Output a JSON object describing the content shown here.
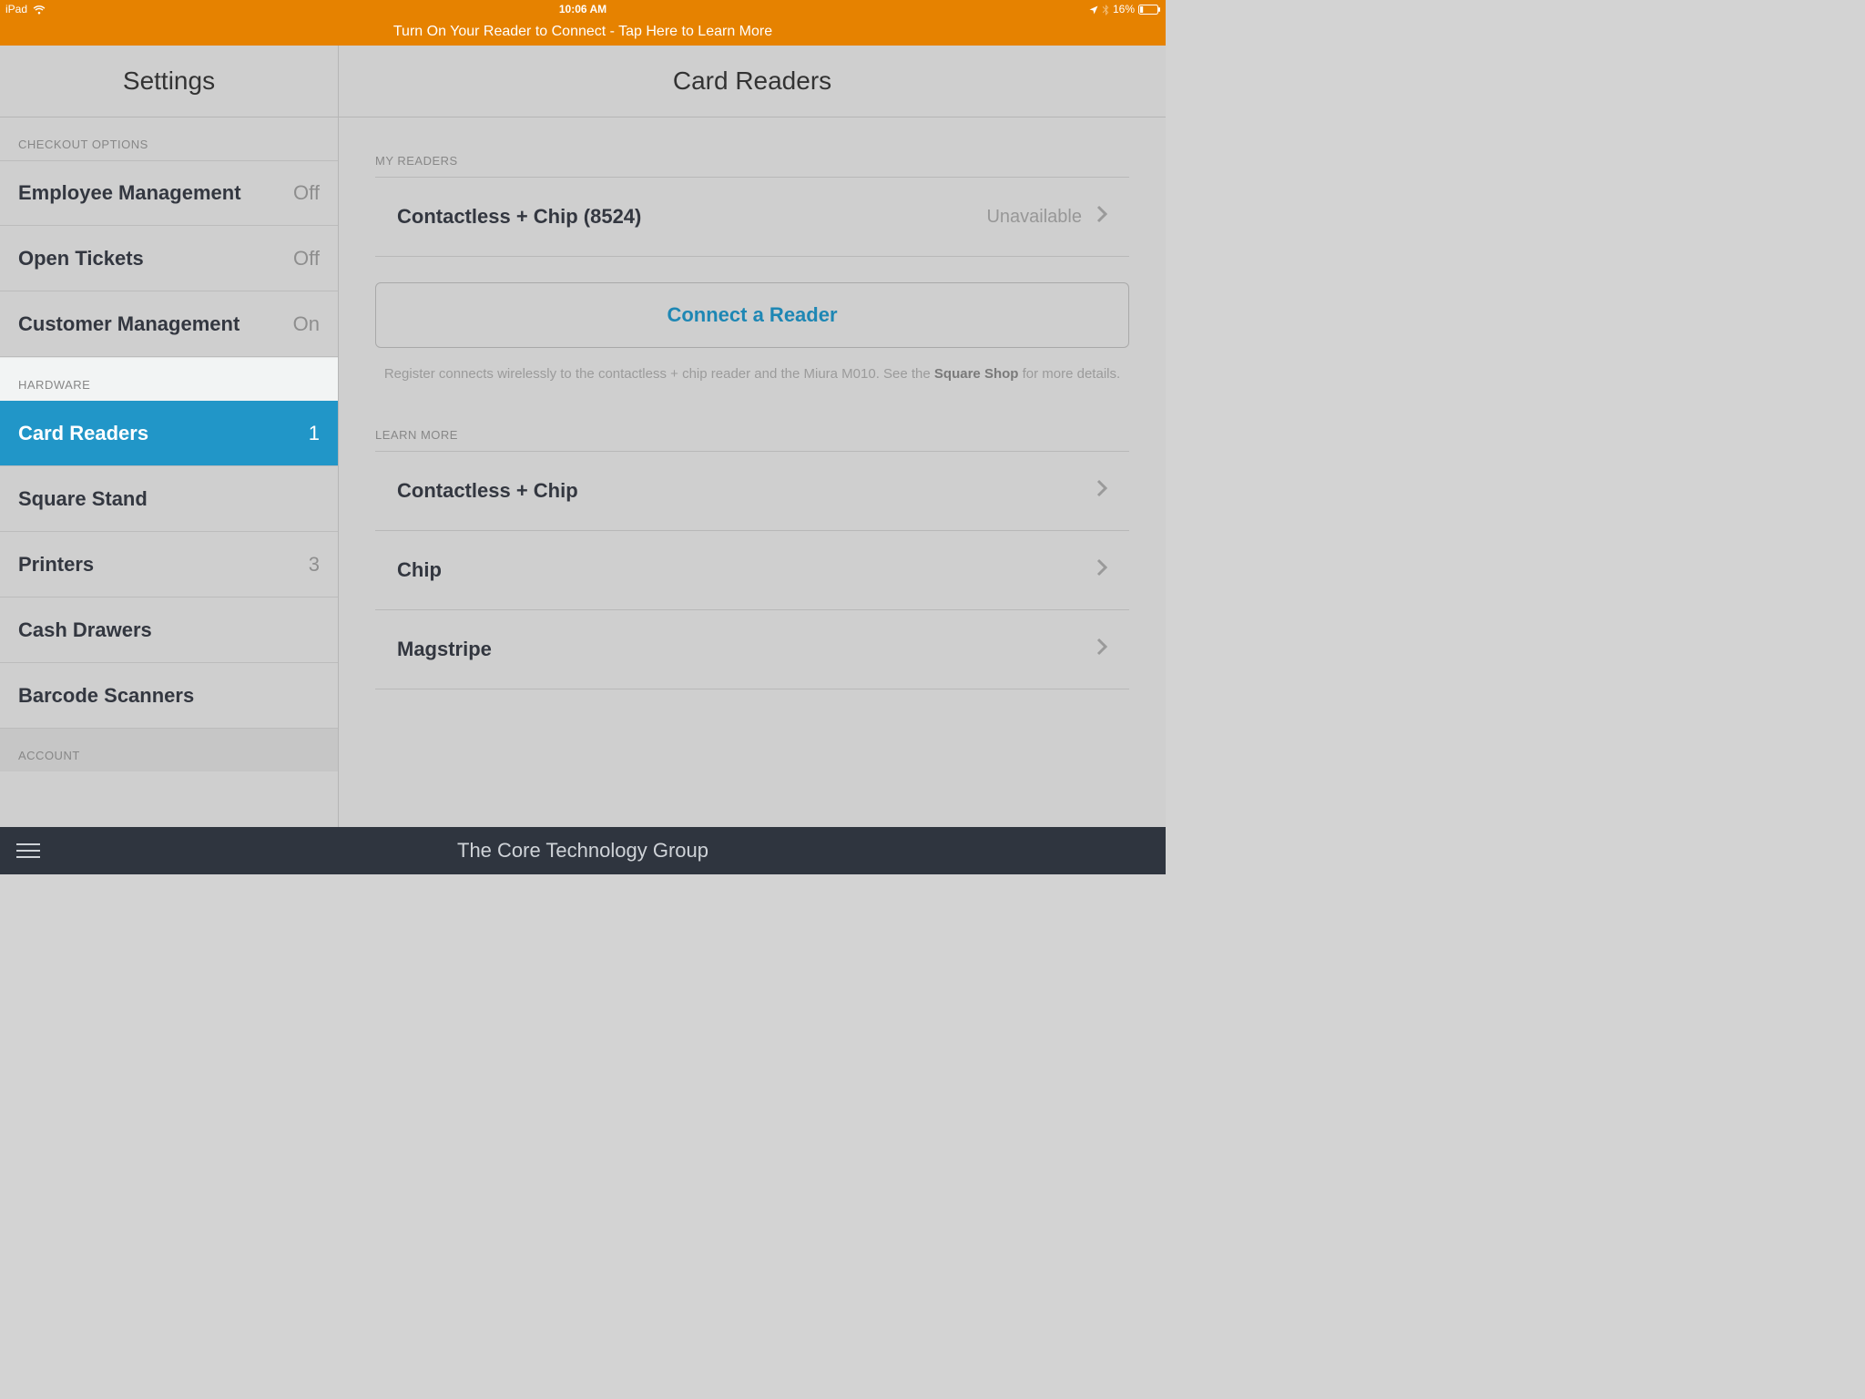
{
  "statusbar": {
    "device": "iPad",
    "time": "10:06 AM",
    "battery": "16%"
  },
  "banner": {
    "text": "Turn On Your Reader to Connect - Tap Here to Learn More"
  },
  "sidebar": {
    "title": "Settings",
    "sections": [
      {
        "header": "CHECKOUT OPTIONS",
        "items": [
          {
            "label": "Employee Management",
            "value": "Off"
          },
          {
            "label": "Open Tickets",
            "value": "Off"
          },
          {
            "label": "Customer Management",
            "value": "On"
          }
        ]
      },
      {
        "header": "HARDWARE",
        "header_bg": "light",
        "items": [
          {
            "label": "Card Readers",
            "value": "1",
            "selected": true
          },
          {
            "label": "Square Stand",
            "value": ""
          },
          {
            "label": "Printers",
            "value": "3"
          },
          {
            "label": "Cash Drawers",
            "value": ""
          },
          {
            "label": "Barcode Scanners",
            "value": ""
          }
        ]
      },
      {
        "header": "ACCOUNT",
        "items": []
      }
    ]
  },
  "content": {
    "title": "Card Readers",
    "my_readers_header": "MY READERS",
    "readers": [
      {
        "name": "Contactless + Chip (8524)",
        "status": "Unavailable"
      }
    ],
    "connect_label": "Connect a Reader",
    "helper_pre": "Register connects wirelessly to the contactless + chip reader and the Miura M010. See the ",
    "helper_strong": "Square Shop",
    "helper_post": " for more details.",
    "learn_more_header": "LEARN MORE",
    "learn_more": [
      {
        "label": "Contactless + Chip"
      },
      {
        "label": "Chip"
      },
      {
        "label": "Magstripe"
      }
    ]
  },
  "footer": {
    "text": "The Core Technology Group"
  }
}
